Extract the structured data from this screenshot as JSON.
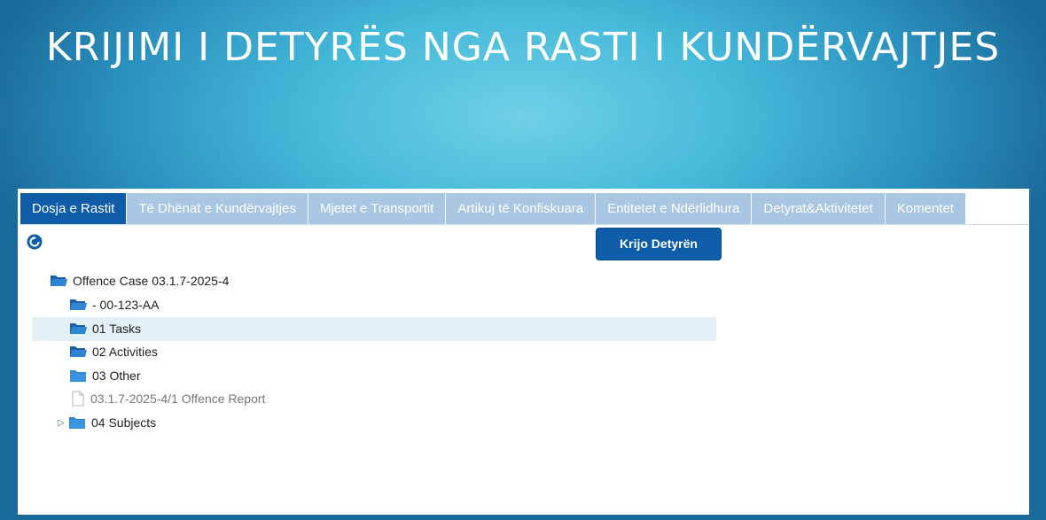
{
  "slide": {
    "title": "KRIJIMI I DETYRËS NGA RASTI I KUNDËRVAJTJES"
  },
  "tabs": [
    {
      "label": "Dosja e Rastit",
      "active": true
    },
    {
      "label": "Të Dhënat e Kundërvajtjes",
      "active": false
    },
    {
      "label": "Mjetet e Transportit",
      "active": false
    },
    {
      "label": "Artikuj të Konfiskuara",
      "active": false
    },
    {
      "label": "Entitetet e Ndërlidhura",
      "active": false
    },
    {
      "label": "Detyrat&Aktivitetet",
      "active": false
    },
    {
      "label": "Komentet",
      "active": false
    }
  ],
  "toolbar": {
    "create_task_label": "Krijo Detyrën",
    "refresh_icon": "refresh-icon"
  },
  "tree": {
    "root": "Offence Case 03.1.7-2025-4",
    "children": [
      {
        "label": "- 00-123-AA",
        "type": "folder-open"
      },
      {
        "label": "01 Tasks",
        "type": "folder-open",
        "selected": true
      },
      {
        "label": "02 Activities",
        "type": "folder-open"
      },
      {
        "label": "03 Other",
        "type": "folder"
      },
      {
        "label": "03.1.7-2025-4/1 Offence Report",
        "type": "file"
      },
      {
        "label": "04 Subjects",
        "type": "folder",
        "expandable": true
      }
    ]
  },
  "colors": {
    "primary": "#0f5ca8",
    "tab_inactive": "#a9c7e3",
    "selection": "#e2eff4"
  }
}
